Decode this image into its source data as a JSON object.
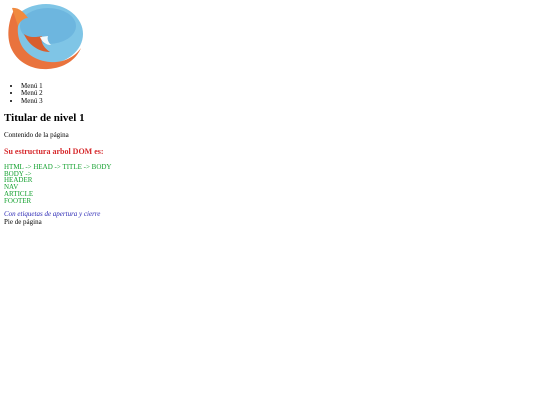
{
  "menu": [
    "Menú 1",
    "Menú 2",
    "Menú 3"
  ],
  "heading": "Titular de nivel 1",
  "content": "Contenido de la página",
  "dom_title": "Su estructura arbol DOM es:",
  "dom_lines": [
    "HTML -> HEAD -> TITLE -> BODY",
    "BODY ->",
    "HEADER",
    "NAV",
    "ARTICLE",
    "FOOTER"
  ],
  "note": "Con etiquetas de apertura y cierre",
  "footer": "Pie de página",
  "colors": {
    "dom_title": "#d6282b",
    "dom_lines": "#14a12f",
    "note": "#2c2ab5",
    "logo_orange": "#e9733d",
    "logo_blue": "#7fc5e6"
  },
  "logo_icon": "firefox-logo"
}
